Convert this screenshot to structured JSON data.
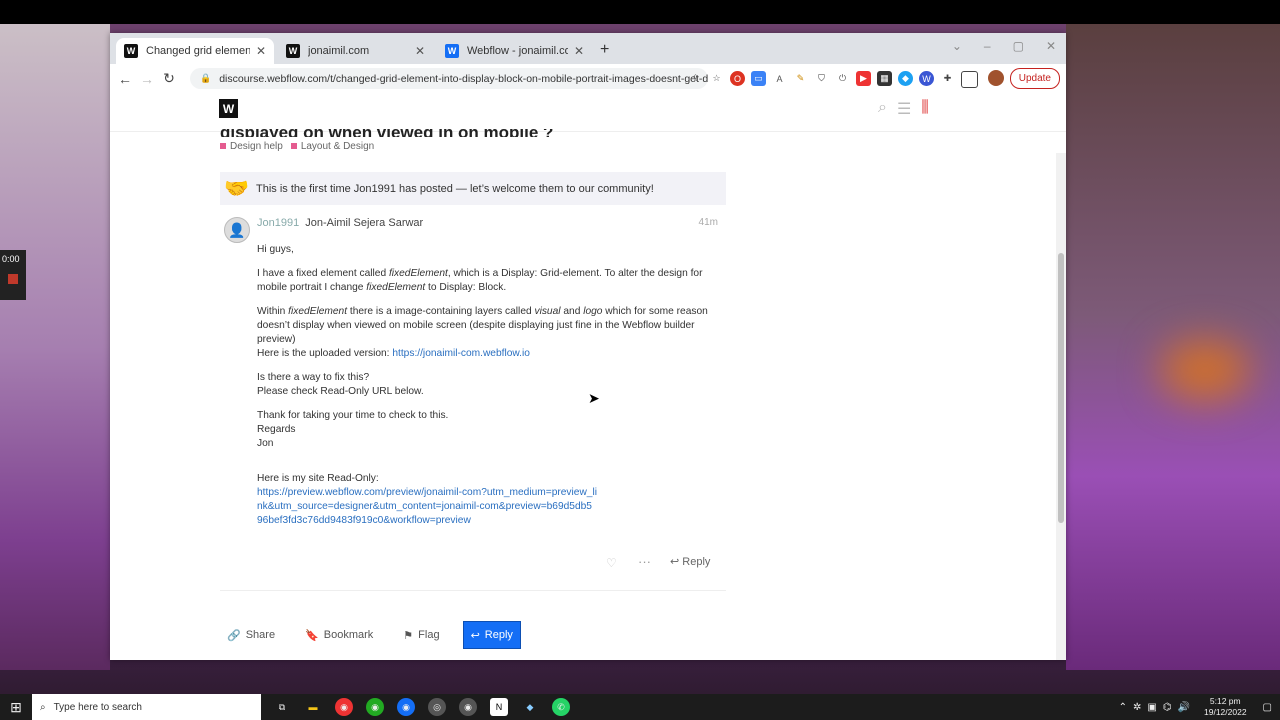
{
  "recording": {
    "time": "0:00"
  },
  "tabs": [
    {
      "title": "Changed grid element into Displ...",
      "favicon": "webflow-favicon",
      "active": true
    },
    {
      "title": "jonaimil.com",
      "favicon": "webflow-favicon",
      "active": false
    },
    {
      "title": "Webflow - jonaimil.com",
      "favicon": "webflow-favicon-blue",
      "active": false
    }
  ],
  "toolbar": {
    "url": "discourse.webflow.com/t/changed-grid-element-into-display-block-on-mobile-portrait-images-doesnt-get-displ...",
    "update_label": "Update"
  },
  "site": {
    "logo": "W",
    "title_fragment": "displayed on when viewed in on mobile ?",
    "categories": [
      {
        "label": "Design help",
        "color": "#e45b8f"
      },
      {
        "label": "Layout & Design",
        "color": "#e45b8f"
      }
    ],
    "banner": "This is the first time Jon1991 has posted — let’s welcome them to our community!"
  },
  "post": {
    "username": "Jon1991",
    "full_name": "Jon-Aimil Sejera Sarwar",
    "age": "41m",
    "greeting": "Hi guys,",
    "p1_a": "I have a fixed element called ",
    "p1_em1": "fixedElement",
    "p1_b": ", which is a Display: Grid-element. To alter the design for mobile portrait I change ",
    "p1_em2": "fixedElement",
    "p1_c": " to Display: Block.",
    "p2_a": "Within ",
    "p2_em1": "fixedElement",
    "p2_b": " there is a image-containing layers called ",
    "p2_em2": "visual",
    "p2_c": " and ",
    "p2_em3": "logo",
    "p2_d": " which for some reason doesn’t display when viewed on mobile screen (despite displaying just fine in the Webflow builder preview)",
    "p2_e": "Here is the uploaded version: ",
    "p2_link": "https://jonaimil-com.webflow.io",
    "p3_a": "Is there a way to fix this?",
    "p3_b": "Please check Read-Only URL below.",
    "p4_a": "Thank for taking your time to check to this.",
    "p4_b": "Regards",
    "p4_c": "Jon",
    "p5_a": "Here is my site Read-Only:",
    "p5_link": "https://preview.webflow.com/preview/jonaimil-com?utm_medium=preview_link&utm_source=designer&utm_content=jonaimil-com&preview=b69d5db596bef3fd3c76dd9483f919c0&workflow=preview",
    "reply_label": "Reply"
  },
  "actions": {
    "share": "Share",
    "bookmark": "Bookmark",
    "flag": "Flag",
    "reply": "Reply"
  },
  "taskbar": {
    "search_placeholder": "Type here to search",
    "time": "5:12 pm",
    "date": "19/12/2022"
  }
}
